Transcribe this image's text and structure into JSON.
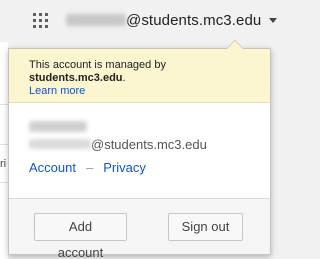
{
  "topbar": {
    "apps_icon": "apps-grid-icon",
    "account_domain": "@students.mc3.edu",
    "caret_icon": "caret-down-icon"
  },
  "background_page": {
    "fragment": "ri"
  },
  "account_popup": {
    "managed_notice": {
      "line1": "This account is managed by",
      "domain": "students.mc3.edu",
      "domain_suffix": ".",
      "learn_more": "Learn more"
    },
    "profile": {
      "email_domain": "@students.mc3.edu"
    },
    "links": {
      "account": "Account",
      "separator": "–",
      "privacy": "Privacy"
    },
    "footer": {
      "add_account": "Add account",
      "sign_out": "Sign out"
    }
  },
  "colors": {
    "link": "#1155cc",
    "notice_bg": "#fbf5d0",
    "footer_bg": "#f5f5f5",
    "topbar_bg": "#f1f1f1"
  }
}
